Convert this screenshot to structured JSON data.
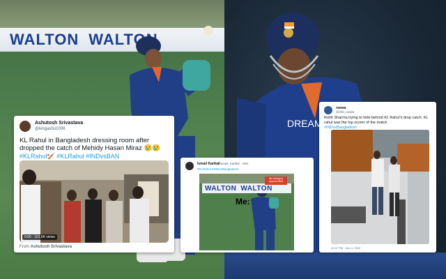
{
  "background": {
    "left_board_text": "WALTON",
    "left_board_text_2": "WALTON",
    "right_jersey_text": "DREAM"
  },
  "tweet1": {
    "name": "Ashutosh Srivastava",
    "handle": "@kingashu1008",
    "body": "KL Rahul in Bangladesh dressing room after dropped the catch of Mehidy Hasan Miraz 😢😢",
    "hashtags": "#KLRahul🏏 #KLRahul #INDvsBAN",
    "video_duration": "0:00",
    "video_views": "101.6K views",
    "from_label": "From",
    "from_name": "Ashutosh Srivastava"
  },
  "tweet2": {
    "name": "Ismail Karikal",
    "handle": "@Ismail_Karikal · 19m",
    "hashtags": "#KLRahul #INDvsBangladesh",
    "meme_board_text": "WALTON",
    "meme_board_text_2": "WALTON",
    "meme_label": "Me:",
    "badge_text": "life changing opportunities"
  },
  "tweet3": {
    "name": "raowa",
    "handle": "@shit_raowa",
    "body": "Rohit Sharma trying to hide behind KL Rahul's drop catch. KL rahul was the top scorer of the match",
    "hashtags": "#INDvsBangladesh",
    "timestamp": "12:47 PM · Dec 4, 2022"
  },
  "colors": {
    "twitter_blue": "#1d9bf0",
    "walton_blue": "#1b3e8f",
    "jersey_blue": "#1f3f8c"
  }
}
